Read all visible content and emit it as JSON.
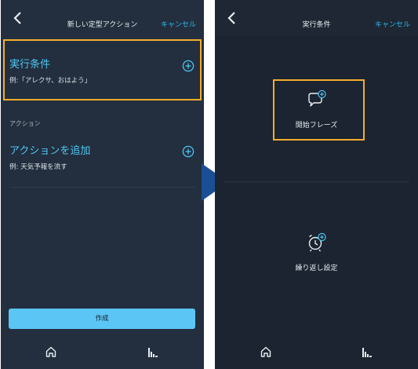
{
  "left_screen": {
    "header": {
      "title": "新しい定型アクション",
      "cancel_label": "キャンセル"
    },
    "trigger_section": {
      "title": "実行条件",
      "example": "例:「アレクサ、おはよう」"
    },
    "action_section": {
      "label": "アクション",
      "title": "アクションを追加",
      "example": "例: 天気予報を流す"
    },
    "create_button_label": "作成",
    "tabs": [
      "home-icon",
      "activity-icon"
    ]
  },
  "right_screen": {
    "header": {
      "title": "実行条件",
      "cancel_label": "キャンセル"
    },
    "options": [
      {
        "label": "開始フレーズ",
        "icon": "speech-bubble-plus-icon"
      },
      {
        "label": "繰り返し設定",
        "icon": "alarm-clock-plus-icon"
      }
    ],
    "tabs": [
      "home-icon",
      "activity-icon"
    ]
  },
  "colors": {
    "background": "#232f3e",
    "accent": "#4ec6f5",
    "highlight": "#f4ad2e",
    "button": "#5bc5f5",
    "arrow": "#1a4f96"
  }
}
